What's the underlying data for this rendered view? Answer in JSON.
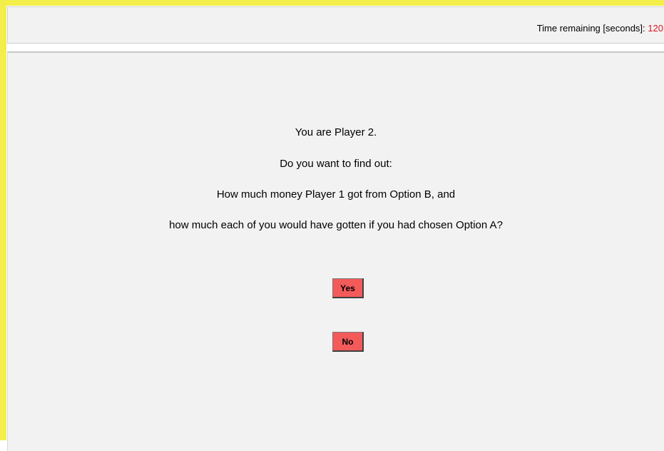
{
  "header": {
    "timer_label": "Time remaining [seconds]:",
    "timer_value": "120"
  },
  "prompt": {
    "line1": "You are Player 2.",
    "line2": "Do you want to find out:",
    "line3": "How much money Player 1 got from Option B, and",
    "line4": "how much each of you would have gotten if you had chosen Option A?"
  },
  "buttons": {
    "yes_label": "Yes",
    "no_label": "No"
  },
  "colors": {
    "frame": "#f4ee4a",
    "panel_bg": "#f2f2f2",
    "button_bg": "#f35a5a",
    "timer_value": "#e0141e"
  }
}
